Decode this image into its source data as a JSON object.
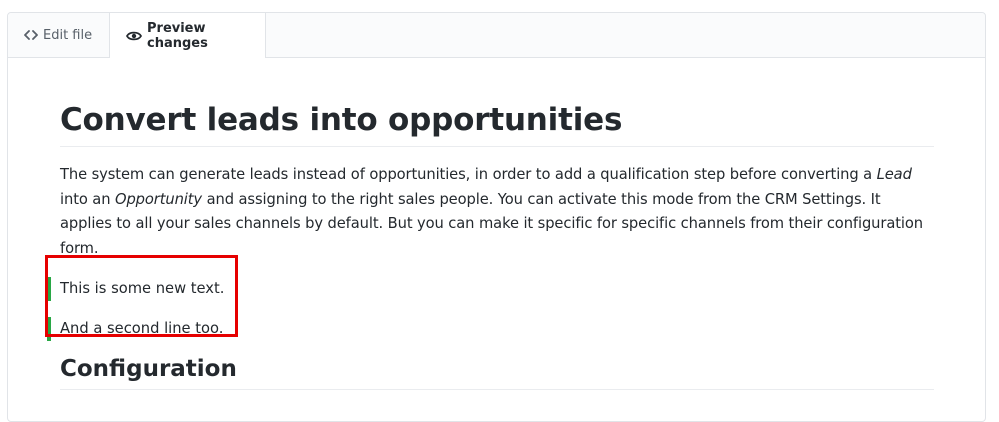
{
  "tabs": {
    "edit_label": "Edit file",
    "preview_label": "Preview changes"
  },
  "article": {
    "title": "Convert leads into opportunities",
    "paragraph": {
      "part1": "The system can generate leads instead of opportunities, in order to add a qualification step before converting a ",
      "lead_em": "Lead",
      "part2": " into an ",
      "opportunity_em": "Opportunity",
      "part3": " and assigning to the right sales people. You can activate this mode from the CRM Settings. It applies to all your sales channels by default. But you can make it specific for specific channels from their configuration form."
    },
    "added_lines": [
      "This is some new text.",
      "And a second line too."
    ],
    "section_heading": "Configuration"
  },
  "colors": {
    "added_marker": "#28a745",
    "highlight_box": "#e60000"
  },
  "icons": {
    "edit_tab": "code-icon",
    "preview_tab": "eye-icon"
  }
}
